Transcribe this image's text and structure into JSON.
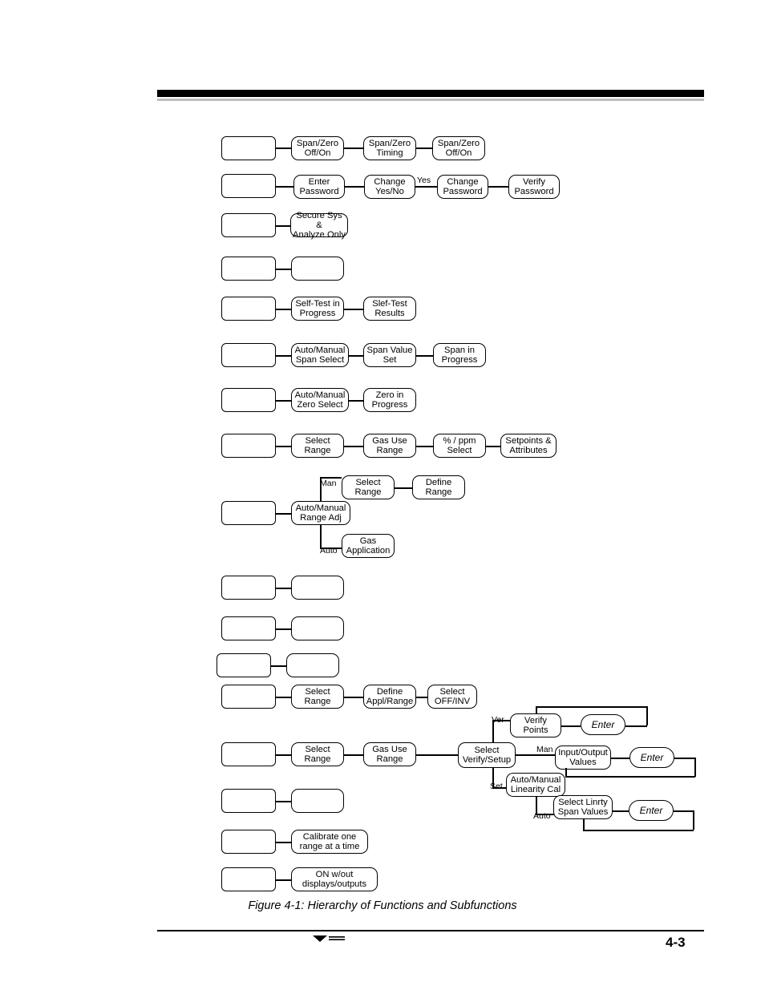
{
  "figure": {
    "caption": "Figure 4-1:  Hierarchy of Functions and Subfunctions",
    "page_number": "4-3"
  },
  "diagram": {
    "type": "hierarchy-tree",
    "rows": [
      {
        "id": "row-span-zero",
        "root": "",
        "nodes": [
          "Span/Zero\nOff/On",
          "Span/Zero\nTiming",
          "Span/Zero\nOff/On"
        ]
      },
      {
        "id": "row-password",
        "root": "",
        "nodes": [
          "Enter\nPassword",
          "Change\nYes/No",
          "Change\nPassword",
          "Verify\nPassword"
        ],
        "edge_labels": [
          "Yes"
        ]
      },
      {
        "id": "row-secure",
        "root": "",
        "nodes": [
          "Secure  Sys  &\nAnalyze  Only"
        ]
      },
      {
        "id": "row-blank-1",
        "root": "",
        "nodes": [
          ""
        ]
      },
      {
        "id": "row-self-test",
        "root": "",
        "nodes": [
          "Self-Test  in\nProgress",
          "Slef-Test\nResults"
        ]
      },
      {
        "id": "row-span",
        "root": "",
        "nodes": [
          "Auto/Manual\nSpan  Select",
          "Span  Value\nSet",
          "Span  in\nProgress"
        ]
      },
      {
        "id": "row-zero",
        "root": "",
        "nodes": [
          "Auto/Manual\nZero  Select",
          "Zero  in\nProgress"
        ]
      },
      {
        "id": "row-range-setup",
        "root": "",
        "nodes": [
          "Select\nRange",
          "Gas  Use\nRange",
          "%  /  ppm\nSelect",
          "Setpoints  &\nAttributes"
        ]
      },
      {
        "id": "row-range-adj",
        "root": "",
        "nodes": [
          "Auto/Manual\nRange  Adj",
          "Select\nRange",
          "Define\nRange",
          "Gas\nApplication"
        ],
        "edge_labels": [
          "Man",
          "Auto"
        ]
      },
      {
        "id": "row-blank-2",
        "root": "",
        "nodes": [
          ""
        ]
      },
      {
        "id": "row-blank-3",
        "root": "",
        "nodes": [
          ""
        ]
      },
      {
        "id": "row-blank-4",
        "root": "",
        "nodes": [
          ""
        ]
      },
      {
        "id": "row-alarm",
        "root": "",
        "nodes": [
          "Select\nRange",
          "Define\nAppl/Range",
          "Select\nOFF/INV"
        ]
      },
      {
        "id": "row-linearity",
        "root": "",
        "nodes": [
          "Select\nRange",
          "Gas  Use\nRange",
          "Select\nVerify/Setup",
          "Verify\nPoints",
          "Input/Output\nValues",
          "Auto/Manual\nLinearity  Cal",
          "Select  Linrty\nSpan  Values"
        ],
        "edge_labels": [
          "Ver",
          "Man",
          "Set",
          "Auto"
        ],
        "enter_buttons": [
          "Enter",
          "Enter",
          "Enter"
        ]
      },
      {
        "id": "row-blank-5",
        "root": "",
        "nodes": [
          ""
        ]
      },
      {
        "id": "row-calibrate",
        "root": "",
        "nodes": [
          "Calibrate  one\nrange  at  a  time"
        ]
      },
      {
        "id": "row-on-without",
        "root": "",
        "nodes": [
          "ON  w/out\ndisplays/outputs"
        ]
      }
    ]
  }
}
